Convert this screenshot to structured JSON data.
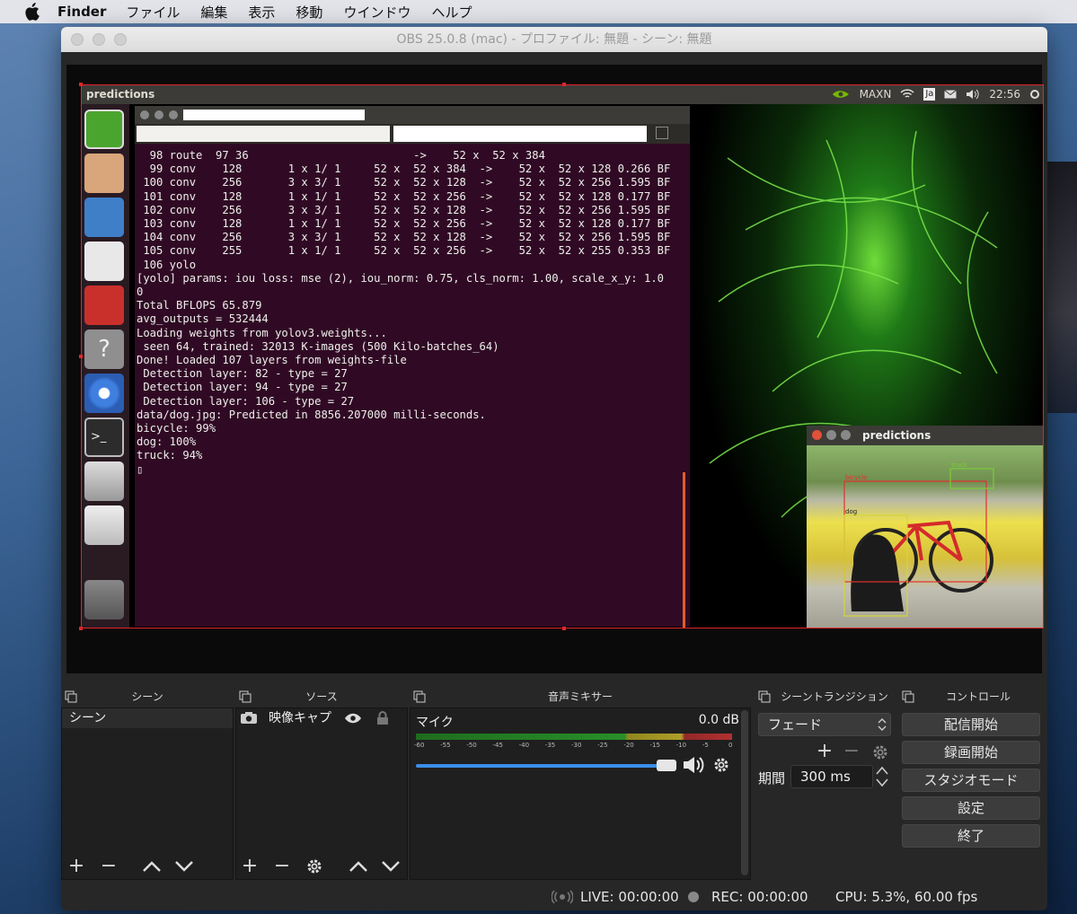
{
  "mac_menubar": {
    "app_name": "Finder",
    "menus": [
      "ファイル",
      "編集",
      "表示",
      "移動",
      "ウインドウ",
      "ヘルプ"
    ]
  },
  "window": {
    "title": "OBS 25.0.8 (mac) - プロファイル: 無題 - シーン: 無題"
  },
  "captured_screen": {
    "topbar_title": "predictions",
    "tray": {
      "gpu_mode": "MAXN",
      "keyboard": "Ja",
      "clock": "22:56"
    },
    "terminal_lines": [
      "  98 route  97 36                         ->    52 x  52 x 384",
      "  99 conv    128       1 x 1/ 1     52 x  52 x 384  ->    52 x  52 x 128 0.266 BF",
      " 100 conv    256       3 x 3/ 1     52 x  52 x 128  ->    52 x  52 x 256 1.595 BF",
      " 101 conv    128       1 x 1/ 1     52 x  52 x 256  ->    52 x  52 x 128 0.177 BF",
      " 102 conv    256       3 x 3/ 1     52 x  52 x 128  ->    52 x  52 x 256 1.595 BF",
      " 103 conv    128       1 x 1/ 1     52 x  52 x 256  ->    52 x  52 x 128 0.177 BF",
      " 104 conv    256       3 x 3/ 1     52 x  52 x 128  ->    52 x  52 x 256 1.595 BF",
      " 105 conv    255       1 x 1/ 1     52 x  52 x 256  ->    52 x  52 x 255 0.353 BF",
      " 106 yolo",
      "[yolo] params: iou loss: mse (2), iou_norm: 0.75, cls_norm: 1.00, scale_x_y: 1.0",
      "0",
      "Total BFLOPS 65.879",
      "avg_outputs = 532444",
      "Loading weights from yolov3.weights...",
      " seen 64, trained: 32013 K-images (500 Kilo-batches_64)",
      "Done! Loaded 107 layers from weights-file",
      " Detection layer: 82 - type = 27",
      " Detection layer: 94 - type = 27",
      " Detection layer: 106 - type = 27",
      "data/dog.jpg: Predicted in 8856.207000 milli-seconds.",
      "bicycle: 99%",
      "dog: 100%",
      "truck: 94%",
      "▯"
    ],
    "prediction_window_title": "predictions",
    "detections": [
      "bicycle",
      "dog",
      "truck"
    ]
  },
  "docks": {
    "scenes": {
      "title": "シーン",
      "items": [
        "シーン"
      ]
    },
    "sources": {
      "title": "ソース",
      "items": [
        {
          "name": "映像キャプ"
        }
      ]
    },
    "mixer": {
      "title": "音声ミキサー",
      "channel": "マイク",
      "level": "0.0 dB",
      "scale": [
        "-60",
        "-55",
        "-50",
        "-45",
        "-40",
        "-35",
        "-30",
        "-25",
        "-20",
        "-15",
        "-10",
        "-5",
        "0"
      ],
      "volume": 1.0
    },
    "transitions": {
      "title": "シーントランジション",
      "selected": "フェード",
      "duration_label": "期間",
      "duration_value": "300 ms"
    },
    "controls": {
      "title": "コントロール",
      "buttons": [
        "配信開始",
        "録画開始",
        "スタジオモード",
        "設定",
        "終了"
      ]
    }
  },
  "status_bar": {
    "live": "LIVE: 00:00:00",
    "rec": "REC: 00:00:00",
    "cpu": "CPU: 5.3%, 60.00 fps"
  },
  "colors": {
    "terminal_bg": "#300a24",
    "selection_red": "#e0252b",
    "volume_blue": "#3a8ee6",
    "ubuntu_orange": "#e05f2a"
  }
}
